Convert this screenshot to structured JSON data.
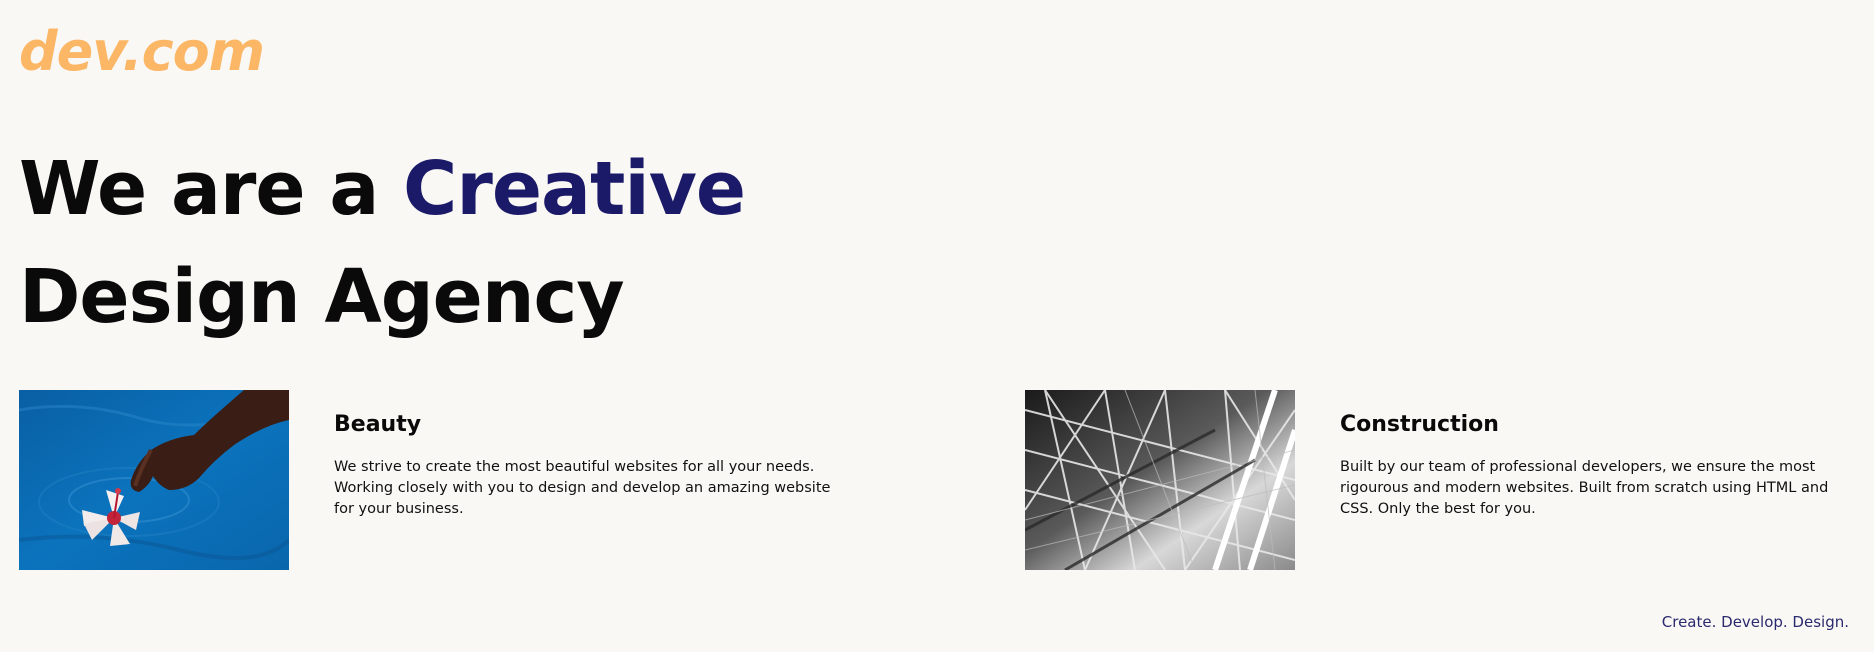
{
  "header": {
    "logo_text": "dev.com"
  },
  "hero": {
    "line1_prefix": "We are a",
    "line1_accent": "Creative",
    "line2": "Design Agency"
  },
  "cards": [
    {
      "title": "Beauty",
      "body": "We strive to create the most beautiful websites for all your needs. Working closely with you to design and develop an amazing website for your business.",
      "image": "hand-with-flower-in-water-photo"
    },
    {
      "title": "Construction",
      "body": "Built by our team of professional developers, we ensure the most rigourous and modern websites. Built from scratch using HTML and CSS. Only the best for you.",
      "image": "steel-structure-photo"
    }
  ],
  "footer": {
    "tagline": "Create. Develop. Design."
  },
  "colors": {
    "background": "#faf8f5",
    "logo": "#fbb766",
    "accent": "#1b1a69",
    "text": "#0a0a0a"
  }
}
